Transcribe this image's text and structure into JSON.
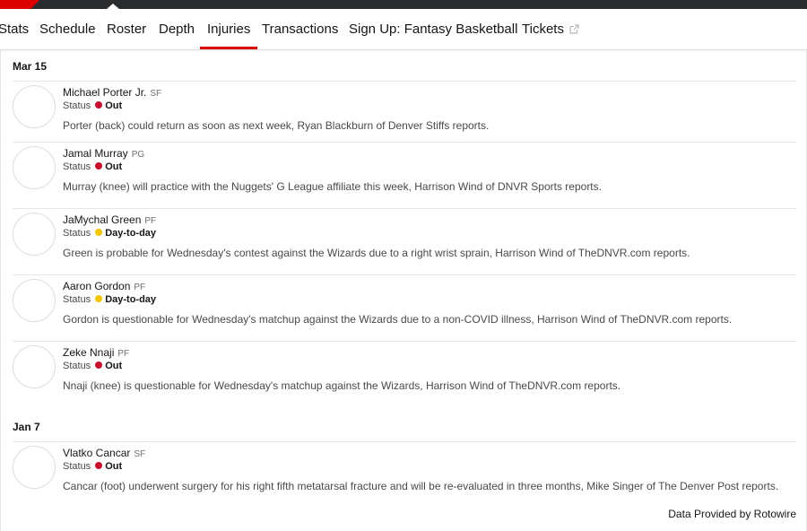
{
  "nav": {
    "items": [
      {
        "label": "Stats",
        "active": false
      },
      {
        "label": "Schedule",
        "active": false
      },
      {
        "label": "Roster",
        "active": false
      },
      {
        "label": "Depth",
        "active": false
      },
      {
        "label": "Injuries",
        "active": true
      },
      {
        "label": "Transactions",
        "active": false
      },
      {
        "label": "Sign Up: Fantasy Basketball",
        "active": false
      },
      {
        "label": "Tickets",
        "active": false,
        "icon": "external-link-icon"
      }
    ]
  },
  "colors": {
    "accent": "#dd0000",
    "out": "#c8102e",
    "day_to_day": "#f4c500"
  },
  "injuries": {
    "groups": [
      {
        "date": "Mar 15",
        "players": [
          {
            "name": "Michael Porter Jr.",
            "position": "SF",
            "status_label": "Status",
            "status": "Out",
            "note": "Porter (back) could return as soon as next week, Ryan Blackburn of Denver Stiffs reports."
          },
          {
            "name": "Jamal Murray",
            "position": "PG",
            "status_label": "Status",
            "status": "Out",
            "note": "Murray (knee) will practice with the Nuggets' G League affiliate this week, Harrison Wind of DNVR Sports reports."
          },
          {
            "name": "JaMychal Green",
            "position": "PF",
            "status_label": "Status",
            "status": "Day-to-day",
            "note": "Green is probable for Wednesday's contest against the Wizards due to a right wrist sprain, Harrison Wind of TheDNVR.com reports."
          },
          {
            "name": "Aaron Gordon",
            "position": "PF",
            "status_label": "Status",
            "status": "Day-to-day",
            "note": "Gordon is questionable for Wednesday's matchup against the Wizards due to a non-COVID illness, Harrison Wind of TheDNVR.com reports."
          },
          {
            "name": "Zeke Nnaji",
            "position": "PF",
            "status_label": "Status",
            "status": "Out",
            "note": "Nnaji (knee) is questionable for Wednesday's matchup against the Wizards, Harrison Wind of TheDNVR.com reports."
          }
        ]
      },
      {
        "date": "Jan 7",
        "players": [
          {
            "name": "Vlatko Cancar",
            "position": "SF",
            "status_label": "Status",
            "status": "Out",
            "note": "Cancar (foot) underwent surgery for his right fifth metatarsal fracture and will be re-evaluated in three months, Mike Singer of The Denver Post reports."
          }
        ]
      }
    ]
  },
  "footer": {
    "credit": "Data Provided by Rotowire"
  }
}
